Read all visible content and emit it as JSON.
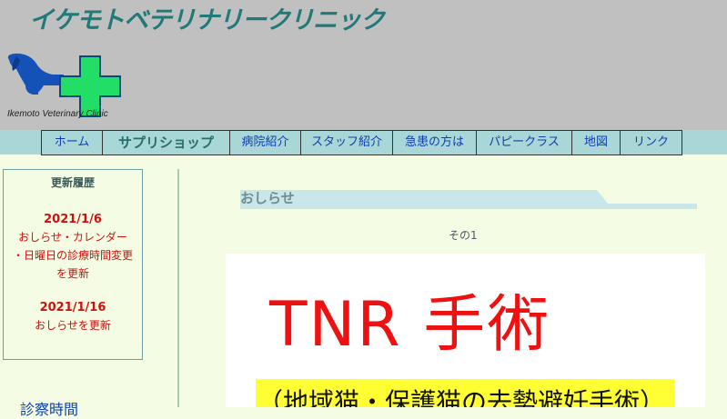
{
  "site": {
    "title": "イケモトベテリナリークリニック",
    "logo_caption": "Ikemoto Veterinary Clinic"
  },
  "nav": {
    "items": [
      {
        "label": "ホーム"
      },
      {
        "label": "サプリショップ"
      },
      {
        "label": "病院紹介"
      },
      {
        "label": "スタッフ紹介"
      },
      {
        "label": "急患の方は"
      },
      {
        "label": "パピークラス"
      },
      {
        "label": "地図"
      },
      {
        "label": "リンク"
      }
    ]
  },
  "sidebar": {
    "history_title": "更新履歴",
    "updates": [
      {
        "date": "2021/1/6",
        "lines": [
          "おしらせ・カレンダー",
          "・日曜日の診療時間変更",
          "を更新"
        ]
      },
      {
        "date": "2021/1/16",
        "lines": [
          "おしらせを更新"
        ]
      }
    ],
    "hours_link": "診察時間"
  },
  "news": {
    "heading": "おしらせ",
    "subheading": "その1",
    "notice_title": "TNR 手術",
    "notice_subtitle": "（地域猫・保護猫の去勢避妊手術）"
  },
  "colors": {
    "header_bg": "#c0c0c0",
    "title": "#1f7a78",
    "nav_bg": "#a9d6d6",
    "accent_red": "#d01010",
    "page_bg": "#f4fde3"
  }
}
